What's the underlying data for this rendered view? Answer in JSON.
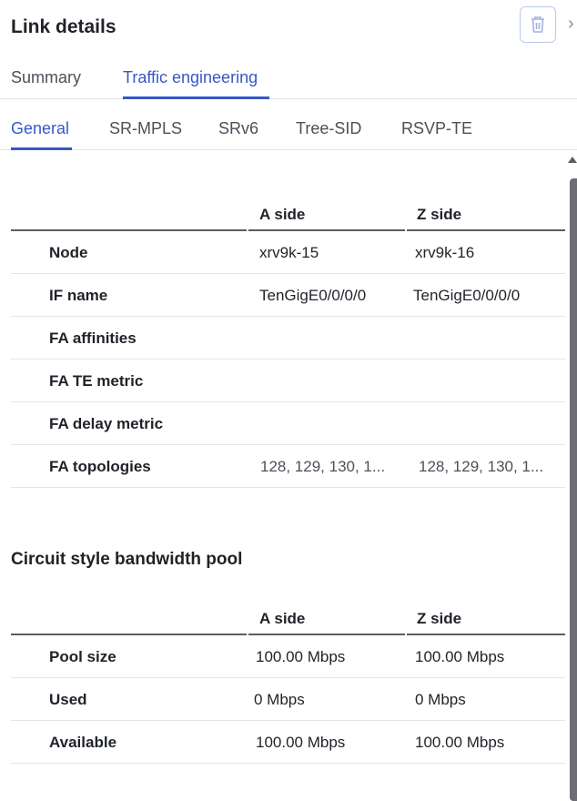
{
  "header": {
    "title": "Link details"
  },
  "icons": {
    "delete": "trash-icon",
    "collapse": "chevron-right-icon"
  },
  "tabs_primary": [
    {
      "label": "Summary",
      "active": false
    },
    {
      "label": "Traffic engineering",
      "active": true
    }
  ],
  "tabs_secondary": [
    {
      "label": "General",
      "active": true
    },
    {
      "label": "SR-MPLS",
      "active": false
    },
    {
      "label": "SRv6",
      "active": false
    },
    {
      "label": "Tree-SID",
      "active": false
    },
    {
      "label": "RSVP-TE",
      "active": false
    }
  ],
  "general_table": {
    "columns": [
      "",
      "A side",
      "Z side"
    ],
    "rows": [
      {
        "label": "Node",
        "a": "xrv9k-15",
        "z": "xrv9k-16"
      },
      {
        "label": "IF name",
        "a": "TenGigE0/0/0/0",
        "z": "TenGigE0/0/0/0"
      },
      {
        "label": "FA affinities",
        "a": "",
        "z": ""
      },
      {
        "label": "FA TE metric",
        "a": "",
        "z": ""
      },
      {
        "label": "FA delay metric",
        "a": "",
        "z": ""
      },
      {
        "label": "FA topologies",
        "a": "128, 129, 130, 1...",
        "z": "128, 129, 130, 1..."
      }
    ]
  },
  "bandwidth_section": {
    "title": "Circuit style bandwidth pool",
    "columns": [
      "",
      "A side",
      "Z side"
    ],
    "rows": [
      {
        "label": "Pool size",
        "a": "100.00 Mbps",
        "z": "100.00 Mbps"
      },
      {
        "label": "Used",
        "a": "0 Mbps",
        "z": "0 Mbps"
      },
      {
        "label": "Available",
        "a": "100.00 Mbps",
        "z": "100.00 Mbps"
      }
    ]
  },
  "colors": {
    "accent": "#3659c5",
    "text": "#1f2329",
    "divider": "#e3e5e8"
  }
}
